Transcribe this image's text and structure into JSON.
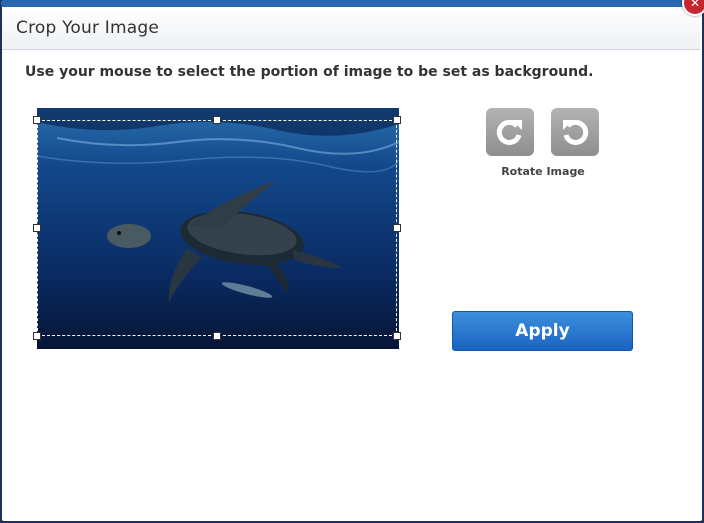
{
  "dialog": {
    "title": "Crop Your Image",
    "instruction": "Use your mouse to select the portion of image to be set as background."
  },
  "controls": {
    "rotate_label": "Rotate Image",
    "rotate_clockwise_icon": "rotate-clockwise-icon",
    "rotate_counterclockwise_icon": "rotate-counterclockwise-icon",
    "apply_label": "Apply"
  },
  "colors": {
    "accent": "#1a63c2",
    "close": "#c6262e",
    "rotate_button": "#9a9a9a"
  }
}
